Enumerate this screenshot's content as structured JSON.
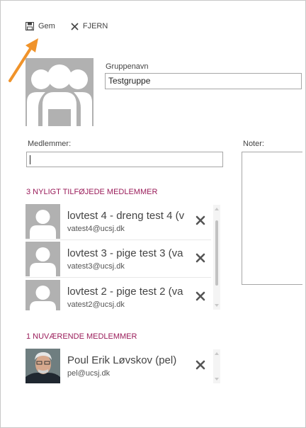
{
  "toolbar": {
    "save_label": "Gem",
    "remove_label": "FJERN"
  },
  "group": {
    "name_label": "Gruppenavn",
    "name_value": "Testgruppe"
  },
  "members_field": {
    "label": "Medlemmer:",
    "value": ""
  },
  "notes": {
    "label": "Noter:"
  },
  "recent": {
    "heading": "3 NYLIGT TILFØJEDE MEDLEMMER",
    "items": [
      {
        "name": "lovtest 4 - dreng test 4 (v",
        "email": "vatest4@ucsj.dk",
        "avatar": "generic-person"
      },
      {
        "name": "lovtest 3 - pige test 3 (va",
        "email": "vatest3@ucsj.dk",
        "avatar": "generic-person"
      },
      {
        "name": "lovtest 2 - pige test 2 (va",
        "email": "vatest2@ucsj.dk",
        "avatar": "generic-person"
      }
    ]
  },
  "current": {
    "heading": "1 NUVÆRENDE MEDLEMMER",
    "items": [
      {
        "name": "Poul Erik Løvskov (pel)",
        "email": "pel@ucsj.dk",
        "avatar": "photo"
      }
    ]
  },
  "colors": {
    "section_heading": "#9a1c5a",
    "arrow": "#f0932a",
    "avatar_bg": "#b1b1b1"
  }
}
